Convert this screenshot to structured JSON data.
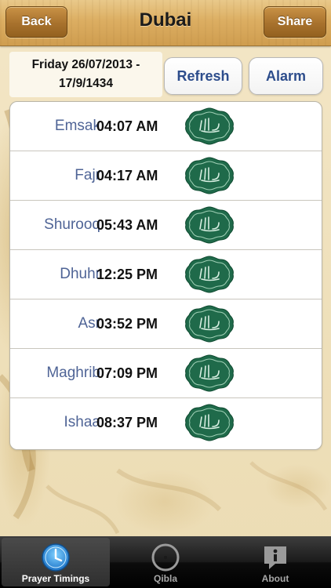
{
  "nav": {
    "back_label": "Back",
    "title": "Dubai",
    "share_label": "Share"
  },
  "date": {
    "line1": "Friday 26/07/2013 -",
    "line2": "17/9/1434"
  },
  "actions": {
    "refresh_label": "Refresh",
    "alarm_label": "Alarm"
  },
  "prayers": [
    {
      "name": "Emsak",
      "time": "04:07 AM"
    },
    {
      "name": "Fajr",
      "time": "04:17 AM"
    },
    {
      "name": "Shurooq",
      "time": "05:43 AM"
    },
    {
      "name": "Dhuhr",
      "time": "12:25 PM"
    },
    {
      "name": "Asr",
      "time": "03:52 PM"
    },
    {
      "name": "Maghrib",
      "time": "07:09 PM"
    },
    {
      "name": "Ishaa",
      "time": "08:37 PM"
    }
  ],
  "tabs": [
    {
      "label": "Prayer Timings",
      "icon": "clock-icon",
      "active": true
    },
    {
      "label": "Qibla",
      "icon": "compass-icon",
      "active": false
    },
    {
      "label": "About",
      "icon": "info-icon",
      "active": false
    }
  ],
  "colors": {
    "prayer_name": "#4f6496",
    "action_text": "#2d4d8c",
    "emblem_green": "#1f6a4a"
  }
}
